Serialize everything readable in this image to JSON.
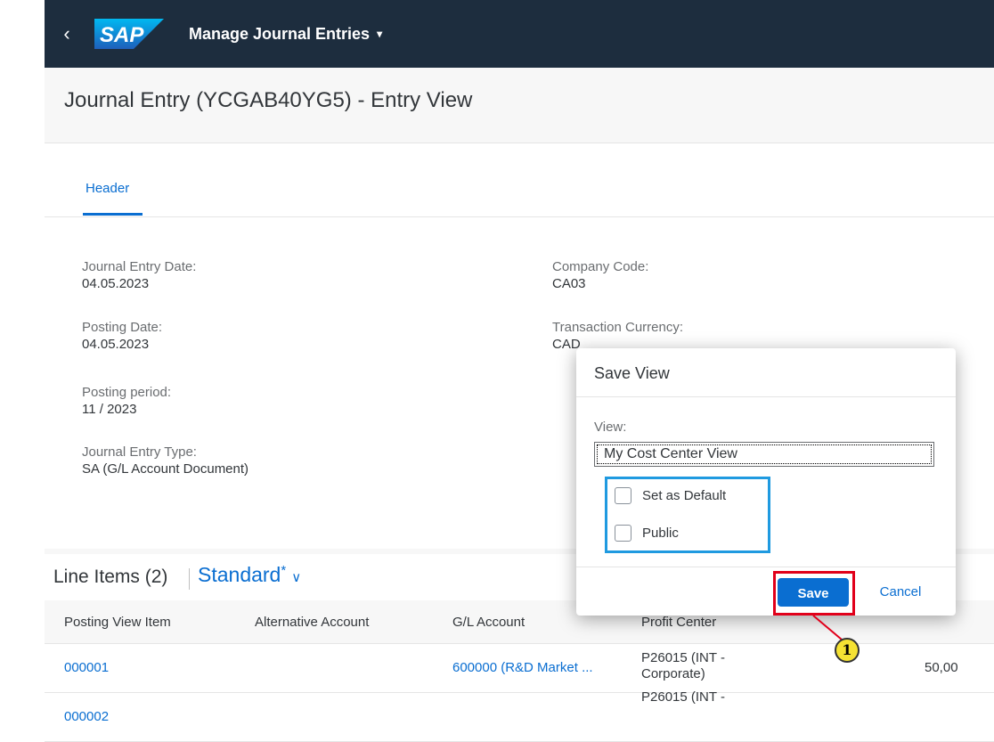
{
  "shell": {
    "back_glyph": "‹",
    "logo_text": "SAP",
    "app_title": "Manage Journal Entries",
    "app_title_caret": "▾"
  },
  "page": {
    "title": "Journal Entry (YCGAB40YG5) - Entry View",
    "tab": "Header"
  },
  "header_fields": {
    "journal_entry_date": {
      "label": "Journal Entry Date:",
      "value": "04.05.2023"
    },
    "posting_date": {
      "label": "Posting Date:",
      "value": "04.05.2023"
    },
    "posting_period": {
      "label": "Posting period:",
      "value": "11 / 2023"
    },
    "journal_entry_type": {
      "label": "Journal Entry Type:",
      "value": "SA (G/L Account Document)"
    },
    "company_code": {
      "label": "Company Code:",
      "value": "CA03"
    },
    "transaction_currency": {
      "label": "Transaction Currency:",
      "value": "CAD"
    }
  },
  "line_items": {
    "title": "Line Items (2)",
    "variant": "Standard",
    "variant_modified": "*",
    "variant_chevron": "∨",
    "columns": [
      "Posting View Item",
      "Alternative Account",
      "G/L Account",
      "Profit Center"
    ],
    "rows": [
      {
        "item": "000001",
        "gl_account": "600000 (R&D Market ...",
        "profit_center_1": "P26015 (INT -",
        "profit_center_2": "Corporate)",
        "amount": "50,00"
      },
      {
        "item": "000002",
        "gl_account": "",
        "profit_center_1": "P26015 (INT -",
        "profit_center_2": "",
        "amount": ""
      }
    ]
  },
  "dialog": {
    "title": "Save View",
    "view_label": "View:",
    "view_value": "My Cost Center View",
    "set_default_label": "Set as Default",
    "public_label": "Public",
    "set_default_checked": false,
    "public_checked": false,
    "save_label": "Save",
    "cancel_label": "Cancel"
  },
  "annotation": {
    "callout_number": "1"
  },
  "colors": {
    "shell_bg": "#1d2d3e",
    "link": "#0a6ed1",
    "highlight_blue": "#1f9ae0",
    "highlight_red": "#e1001a",
    "callout_fill": "#f5e233"
  }
}
